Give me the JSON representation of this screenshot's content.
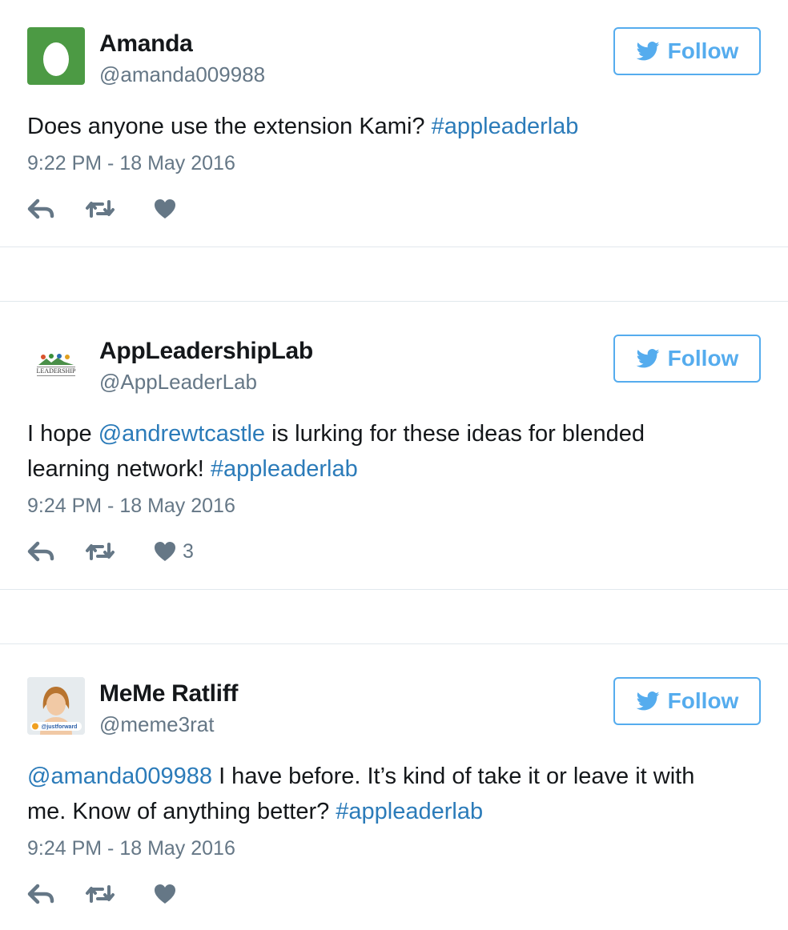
{
  "colors": {
    "accent": "#55acee",
    "link": "#2b7bb9",
    "muted": "#657786",
    "divider": "#e1e8ed"
  },
  "tweets": [
    {
      "name": "Amanda",
      "handle": "@amanda009988",
      "follow_label": "Follow",
      "text": [
        {
          "t": "Does anyone use the extension Kami? ",
          "link": false
        },
        {
          "t": "#appleaderlab",
          "link": true
        }
      ],
      "time": "9:22 PM - 18 May 2016",
      "like_count": ""
    },
    {
      "name": "AppLeadershipLab",
      "handle": "@AppLeaderLab",
      "follow_label": "Follow",
      "avatar_text": "LEADERSHIP",
      "text": [
        {
          "t": "I hope ",
          "link": false
        },
        {
          "t": "@andrewtcastle",
          "link": true
        },
        {
          "t": " is lurking for these ideas for blended learning network! ",
          "link": false
        },
        {
          "t": "#appleaderlab",
          "link": true
        }
      ],
      "time": "9:24 PM - 18 May 2016",
      "like_count": "3"
    },
    {
      "name": "MeMe Ratliff",
      "handle": "@meme3rat",
      "follow_label": "Follow",
      "avatar_text": "@justforward",
      "text": [
        {
          "t": "@amanda009988",
          "link": true
        },
        {
          "t": " I have before. It’s kind of take it or leave it with me. Know of anything better? ",
          "link": false
        },
        {
          "t": "#appleaderlab",
          "link": true
        }
      ],
      "time": "9:24 PM - 18 May 2016",
      "like_count": ""
    }
  ]
}
